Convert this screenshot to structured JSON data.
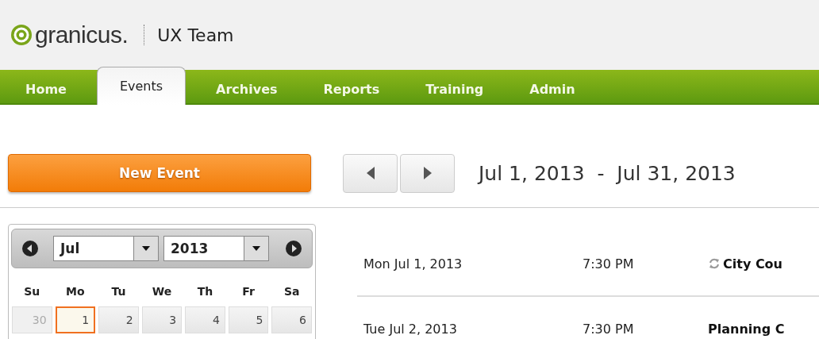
{
  "header": {
    "logo_text": "granicus.",
    "team": "UX Team"
  },
  "tabs": [
    {
      "label": "Home",
      "selected": false
    },
    {
      "label": "Events",
      "selected": true
    },
    {
      "label": "Archives",
      "selected": false
    },
    {
      "label": "Reports",
      "selected": false
    },
    {
      "label": "Training",
      "selected": false
    },
    {
      "label": "Admin",
      "selected": false
    }
  ],
  "new_event_button": "New Event",
  "date_range": "Jul 1, 2013  -  Jul 31, 2013",
  "calendar": {
    "month": "Jul",
    "year": "2013",
    "weekdays": [
      "Su",
      "Mo",
      "Tu",
      "We",
      "Th",
      "Fr",
      "Sa"
    ],
    "days": [
      {
        "label": "30",
        "other_month": true,
        "today": false
      },
      {
        "label": "1",
        "other_month": false,
        "today": true
      },
      {
        "label": "2",
        "other_month": false,
        "today": false
      },
      {
        "label": "3",
        "other_month": false,
        "today": false
      },
      {
        "label": "4",
        "other_month": false,
        "today": false
      },
      {
        "label": "5",
        "other_month": false,
        "today": false
      },
      {
        "label": "6",
        "other_month": false,
        "today": false
      }
    ]
  },
  "events": [
    {
      "date": "Mon Jul 1, 2013",
      "time": "7:30 PM",
      "title": "City Cou",
      "recurring": true
    },
    {
      "date": "Tue Jul 2, 2013",
      "time": "7:30 PM",
      "title": "Planning C",
      "recurring": false
    }
  ]
}
